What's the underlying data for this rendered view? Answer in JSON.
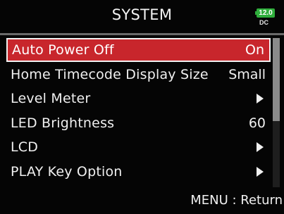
{
  "header": {
    "title": "SYSTEM",
    "battery": {
      "value": "12.0",
      "source": "DC",
      "color": "#2fae3c"
    }
  },
  "menu": {
    "selected_color": "#c8262c",
    "items": [
      {
        "label": "Auto Power Off",
        "value": "On",
        "selected": true
      },
      {
        "label": "Home Timecode Display Size",
        "value": "Small"
      },
      {
        "label": "Level Meter",
        "value": "",
        "has_submenu": true
      },
      {
        "label": "LED Brightness",
        "value": "60"
      },
      {
        "label": "LCD",
        "value": "",
        "has_submenu": true
      },
      {
        "label": "PLAY Key Option",
        "value": "",
        "has_submenu": true
      }
    ]
  },
  "footer": {
    "hint": "MENU : Return"
  }
}
